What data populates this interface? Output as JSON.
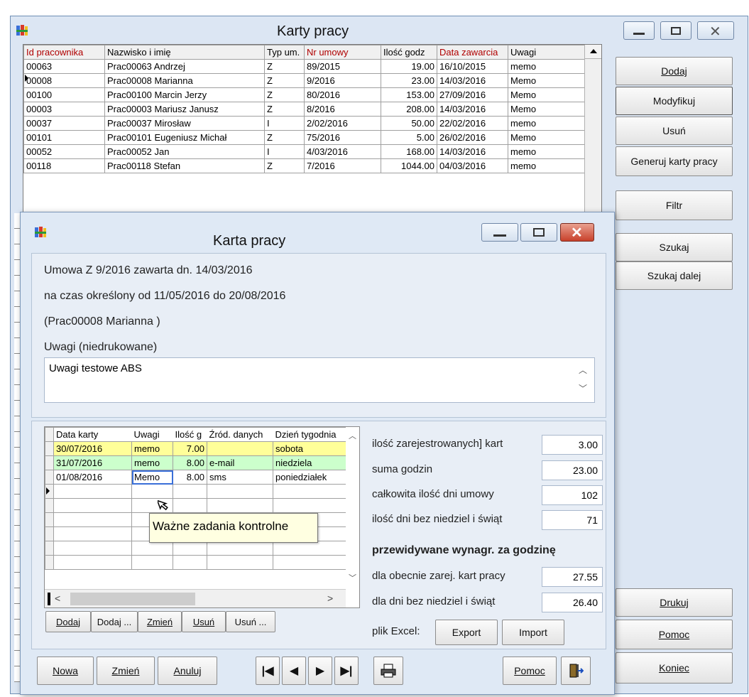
{
  "main": {
    "title": "Karty pracy",
    "columns": [
      "Id pracownika",
      "Nazwisko i imię",
      "Typ um.",
      "Nr umowy",
      "Ilość godz",
      "Data zawarcia",
      "Uwagi"
    ],
    "rows": [
      [
        "00063",
        "Prac00063 Andrzej",
        "Z",
        "89/2015",
        "19.00",
        "16/10/2015",
        "memo"
      ],
      [
        "00008",
        "Prac00008 Marianna",
        "Z",
        "9/2016",
        "23.00",
        "14/03/2016",
        "Memo"
      ],
      [
        "00100",
        "Prac00100 Marcin Jerzy",
        "Z",
        "80/2016",
        "153.00",
        "27/09/2016",
        "Memo"
      ],
      [
        "00003",
        "Prac00003 Mariusz Janusz",
        "Z",
        "8/2016",
        "208.00",
        "14/03/2016",
        "Memo"
      ],
      [
        "00037",
        "Prac00037 Mirosław",
        "I",
        "2/02/2016",
        "50.00",
        "22/02/2016",
        "memo"
      ],
      [
        "00101",
        "Prac00101 Eugeniusz Michał",
        "Z",
        "75/2016",
        "5.00",
        "26/02/2016",
        "Memo"
      ],
      [
        "00052",
        "Prac00052 Jan",
        "I",
        "4/03/2016",
        "168.00",
        "14/03/2016",
        "memo"
      ],
      [
        "00118",
        "Prac00118 Stefan",
        "Z",
        "7/2016",
        "1044.00",
        "04/03/2016",
        "memo"
      ]
    ],
    "side_buttons": {
      "dodaj": "Dodaj",
      "modyfikuj": "Modyfikuj",
      "usun": "Usuń",
      "generuj": "Generuj karty pracy",
      "filtr": "Filtr",
      "szukaj": "Szukaj",
      "szukaj_dalej": "Szukaj dalej",
      "drukuj": "Drukuj",
      "pomoc": "Pomoc",
      "koniec": "Koniec"
    }
  },
  "dialog": {
    "title": "Karta pracy",
    "line1": "Umowa Z 9/2016 zawarta dn. 14/03/2016",
    "line2": "na czas określony od 11/05/2016 do 20/08/2016",
    "line3": "(Prac00008 Marianna )",
    "notes_label": "Uwagi (niedrukowane)",
    "notes_value": "Uwagi testowe ABS",
    "grid_columns": [
      "Data karty",
      "Uwagi",
      "Ilość g",
      "Źród. danych",
      "Dzień tygodnia"
    ],
    "grid_rows": [
      {
        "date": "30/07/2016",
        "note": "memo",
        "hours": "7.00",
        "source": "",
        "day": "sobota",
        "color": "#ffff99"
      },
      {
        "date": "31/07/2016",
        "note": "memo",
        "hours": "8.00",
        "source": "e-mail",
        "day": "niedziela",
        "color": "#ccffcc"
      },
      {
        "date": "01/08/2016",
        "note": "Memo",
        "hours": "8.00",
        "source": "sms",
        "day": "poniedziałek",
        "color": "#ffffff"
      }
    ],
    "tooltip": "Ważne zadania kontrolne",
    "grid_buttons": [
      "Dodaj",
      "Dodaj ...",
      "Zmień",
      "Usuń",
      "Usuń ..."
    ],
    "stats": [
      {
        "label": "ilość zarejestrowanych] kart",
        "value": "3.00"
      },
      {
        "label": "suma godzin",
        "value": "23.00"
      },
      {
        "label": "całkowita ilość dni umowy",
        "value": "102"
      },
      {
        "label": "ilość dni bez niedziel i świąt",
        "value": "71"
      }
    ],
    "rate_heading": "przewidywane wynagr. za godzinę",
    "rates": [
      {
        "label": "dla obecnie zarej. kart pracy",
        "value": "27.55"
      },
      {
        "label": "dla dni bez niedziel i świąt",
        "value": "26.40"
      }
    ],
    "excel_label": "plik Excel:",
    "export_label": "Export",
    "import_label": "Import",
    "bottom": {
      "nowa": "Nowa",
      "zmien": "Zmień",
      "anuluj": "Anuluj",
      "pomoc": "Pomoc"
    }
  }
}
